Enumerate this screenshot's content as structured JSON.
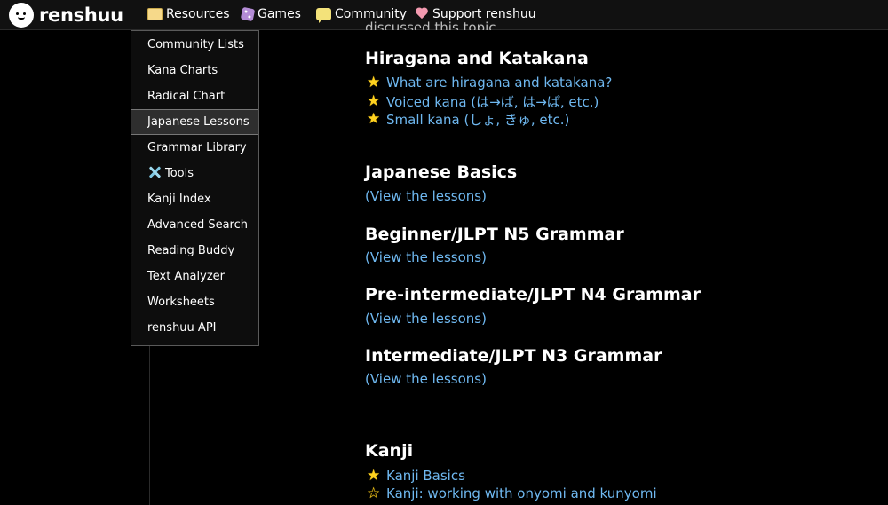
{
  "brand": {
    "name": "renshuu"
  },
  "nav": {
    "resources": "Resources",
    "games": "Games",
    "community": "Community",
    "support": "Support renshuu"
  },
  "dropdown": {
    "items": [
      {
        "label": "Community Lists"
      },
      {
        "label": "Kana Charts"
      },
      {
        "label": "Radical Chart"
      },
      {
        "label": "Japanese Lessons",
        "active": true
      },
      {
        "label": "Grammar Library"
      },
      {
        "label": "Tools",
        "icon": "tools-icon"
      },
      {
        "label": "Kanji Index"
      },
      {
        "label": "Advanced Search"
      },
      {
        "label": "Reading Buddy"
      },
      {
        "label": "Text Analyzer"
      },
      {
        "label": "Worksheets"
      },
      {
        "label": "renshuu API"
      }
    ]
  },
  "content": {
    "cut_text": "discussed this topic.",
    "hiragana": {
      "title": "Hiragana and Katakana",
      "links": [
        "What are hiragana and katakana?",
        "Voiced kana (は→ば, は→ぱ, etc.)",
        "Small kana (しょ, きゅ, etc.)"
      ]
    },
    "sections": [
      {
        "title": "Japanese Basics",
        "link": "(View the lessons)"
      },
      {
        "title": "Beginner/JLPT N5 Grammar",
        "link": "(View the lessons)"
      },
      {
        "title": "Pre-intermediate/JLPT N4 Grammar",
        "link": "(View the lessons)"
      },
      {
        "title": "Intermediate/JLPT N3 Grammar",
        "link": "(View the lessons)"
      }
    ],
    "kanji": {
      "title": "Kanji",
      "links": [
        "Kanji Basics",
        "Kanji: working with onyomi and kunyomi"
      ]
    }
  },
  "colors": {
    "background": "#000000",
    "link": "#6fb8f0",
    "star": "#ffd21f"
  }
}
